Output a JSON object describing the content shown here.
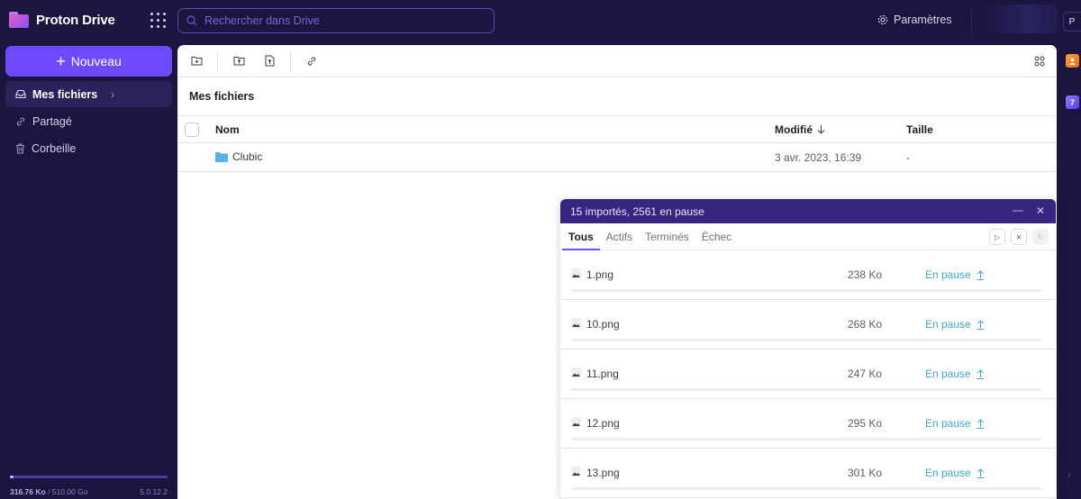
{
  "app": {
    "name": "Proton Drive"
  },
  "header": {
    "search_placeholder": "Rechercher dans Drive",
    "settings_label": "Paramètres",
    "avatar_initial": "P"
  },
  "sidebar": {
    "new_label": "Nouveau",
    "items": [
      {
        "label": "Mes fichiers",
        "icon": "inbox-icon",
        "active": true
      },
      {
        "label": "Partagé",
        "icon": "link-icon",
        "active": false
      },
      {
        "label": "Corbeille",
        "icon": "trash-icon",
        "active": false
      }
    ],
    "storage": {
      "used": "316.76 Ko",
      "separator": " / ",
      "total": "510.00 Go",
      "used_fraction": 6e-07
    },
    "version": "5.0.12.2"
  },
  "toolbar": {
    "buttons": [
      "new-folder",
      "upload-folder",
      "upload-file",
      "share-link"
    ],
    "view_toggle": "grid-view"
  },
  "main": {
    "breadcrumb": "Mes fichiers",
    "columns": {
      "name": "Nom",
      "modified": "Modifié",
      "size": "Taille"
    },
    "sort": {
      "column": "modified",
      "direction": "desc"
    },
    "rows": [
      {
        "name": "Clubic",
        "type": "folder",
        "modified": "3 avr. 2023, 16:39",
        "size": "-"
      }
    ]
  },
  "upload": {
    "title": "15 importés, 2561 en pause",
    "tabs": [
      {
        "label": "Tous",
        "active": true
      },
      {
        "label": "Actifs",
        "active": false
      },
      {
        "label": "Terminés",
        "active": false
      },
      {
        "label": "Échec",
        "active": false
      }
    ],
    "items": [
      {
        "name": "1.png",
        "size": "238 Ko",
        "status": "En pause",
        "progress": 0
      },
      {
        "name": "10.png",
        "size": "268 Ko",
        "status": "En pause",
        "progress": 0
      },
      {
        "name": "11.png",
        "size": "247 Ko",
        "status": "En pause",
        "progress": 0
      },
      {
        "name": "12.png",
        "size": "295 Ko",
        "status": "En pause",
        "progress": 0
      },
      {
        "name": "13.png",
        "size": "301 Ko",
        "status": "En pause",
        "progress": 0
      }
    ]
  },
  "rail": {
    "calendar_day": "7"
  },
  "colors": {
    "accent": "#6d4aff",
    "background": "#1b1540",
    "upload_header": "#372580",
    "status": "#3da7d8"
  }
}
